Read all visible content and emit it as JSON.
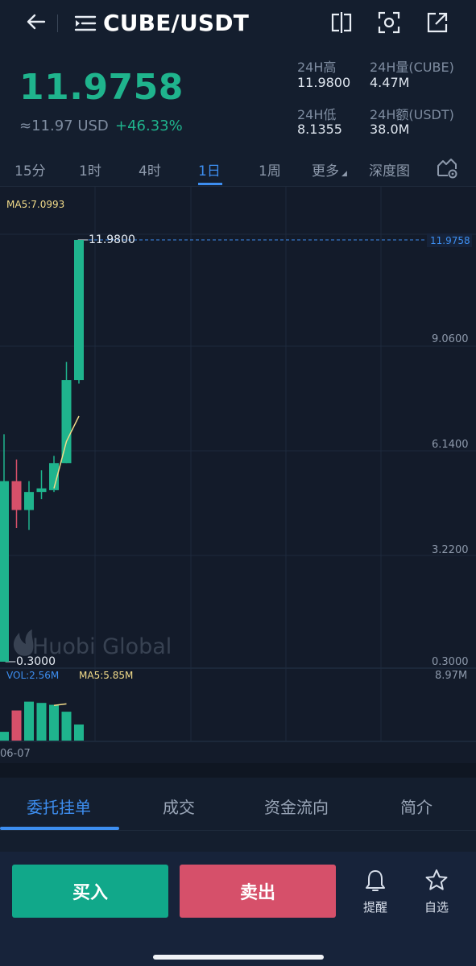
{
  "header": {
    "pair": "CUBE/USDT",
    "icons": [
      "back-arrow-icon",
      "switch-list-icon",
      "split-screen-icon",
      "scan-icon",
      "share-icon"
    ]
  },
  "ticker": {
    "price": "11.9758",
    "usd_price": "≈11.97 USD",
    "change": "+46.33%",
    "high_label": "24H高",
    "high_value": "11.9800",
    "volume_label": "24H量(CUBE)",
    "volume_value": "4.47M",
    "low_label": "24H低",
    "low_value": "8.1355",
    "turnover_label": "24H额(USDT)",
    "turnover_value": "38.0M"
  },
  "timeframes": {
    "items": [
      "15分",
      "1时",
      "4时",
      "1日",
      "1周",
      "更多",
      "深度图"
    ],
    "active": "1日"
  },
  "chart": {
    "ma_label": "MA5:7.0993",
    "high_marker": "—11.9800",
    "low_marker": "—0.3000",
    "current_price_tag": "11.9758",
    "y_ticks": [
      "9.0600",
      "6.1400",
      "3.2200",
      "0.3000"
    ],
    "watermark": "Huobi Global",
    "vol_label": "VOL:2.56M",
    "vol_ma_label": "MA5:5.85M",
    "vol_max": "8.97M",
    "x_label": "06-07",
    "colors": {
      "up": "#1fb48d",
      "down": "#d6506a",
      "ma": "#f3dc8a",
      "accent": "#3d8ef0"
    }
  },
  "chart_data": {
    "type": "candlestick",
    "ylim": [
      0.3,
      11.98
    ],
    "y_ticks": [
      9.06,
      6.14,
      3.22,
      0.3
    ],
    "candles": [
      {
        "open": 0.3,
        "close": 5.3,
        "high": 6.6,
        "low": 0.3,
        "dir": "up"
      },
      {
        "open": 5.3,
        "close": 4.5,
        "high": 5.9,
        "low": 4.0,
        "dir": "down"
      },
      {
        "open": 4.5,
        "close": 5.0,
        "high": 5.3,
        "low": 3.95,
        "dir": "up"
      },
      {
        "open": 5.0,
        "close": 5.1,
        "high": 5.6,
        "low": 4.8,
        "dir": "up"
      },
      {
        "open": 5.05,
        "close": 5.8,
        "high": 6.0,
        "low": 5.0,
        "dir": "up"
      },
      {
        "open": 5.8,
        "close": 8.1,
        "high": 8.6,
        "low": 5.8,
        "dir": "up"
      },
      {
        "open": 8.1,
        "close": 11.98,
        "high": 11.98,
        "low": 8.0,
        "dir": "up"
      }
    ],
    "ma5": [
      [
        4,
        5.1
      ],
      [
        5,
        6.4
      ],
      [
        6,
        7.1
      ]
    ],
    "volume": {
      "max": 8.97,
      "values": [
        1.4,
        4.8,
        6.2,
        6.0,
        5.7,
        4.6,
        2.56
      ],
      "dirs": [
        "up",
        "down",
        "up",
        "up",
        "up",
        "up",
        "up"
      ],
      "ma5": [
        [
          4,
          5.6
        ],
        [
          5,
          5.85
        ]
      ]
    }
  },
  "bottom_tabs": {
    "items": [
      "委托挂单",
      "成交",
      "资金流向",
      "简介"
    ],
    "active": "委托挂单"
  },
  "actions": {
    "buy": "买入",
    "sell": "卖出",
    "alert": "提醒",
    "favorite": "自选"
  }
}
